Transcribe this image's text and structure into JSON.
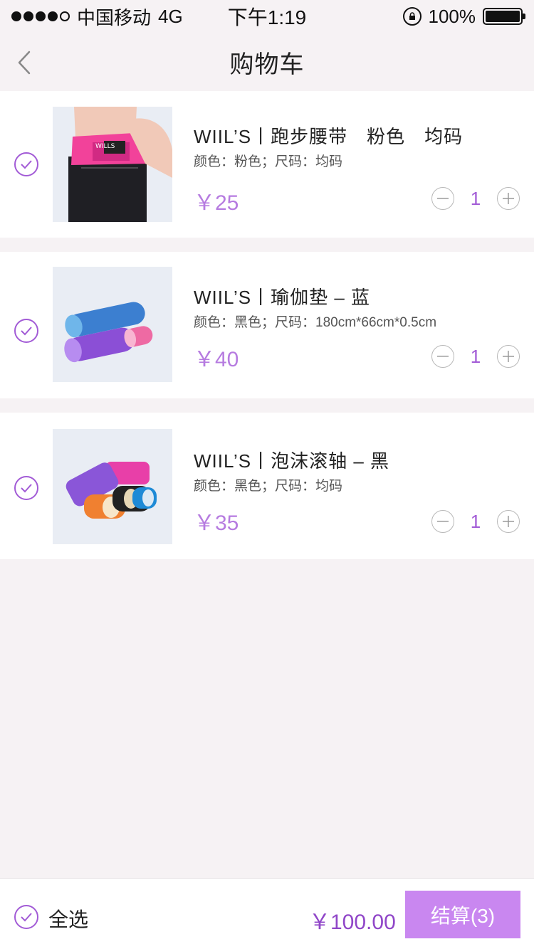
{
  "status_bar": {
    "carrier": "中国移动",
    "network": "4G",
    "time": "下午1:19",
    "battery": "100%"
  },
  "nav": {
    "title": "购物车"
  },
  "items": [
    {
      "name": "WIIL’S丨跑步腰带　粉色　均码",
      "spec": "颜色：粉色；尺码：均码",
      "price": "￥25",
      "quantity": "1"
    },
    {
      "name": "WIIL’S丨瑜伽垫 – 蓝",
      "spec": "颜色：黑色；尺码：180cm*66cm*0.5cm",
      "price": "￥40",
      "quantity": "1"
    },
    {
      "name": "WIIL’S丨泡沫滚轴 – 黑",
      "spec": "颜色：黑色；尺码：均码",
      "price": "￥35",
      "quantity": "1"
    }
  ],
  "footer": {
    "select_all_label": "全选",
    "total": "￥100.00",
    "checkout_label": "结算(3)"
  },
  "colors": {
    "accent": "#a25bd6",
    "price": "#b67be0",
    "checkout_bg": "#c987f0"
  }
}
